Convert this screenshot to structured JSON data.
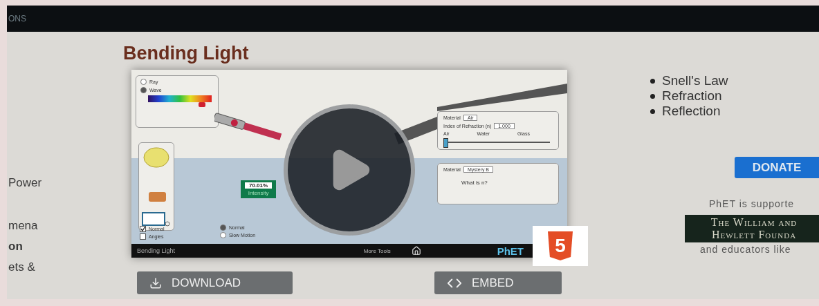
{
  "nav": {
    "label": "ONS"
  },
  "sidebar": {
    "items": [
      {
        "label": "Power",
        "selected": false
      },
      {
        "label": "mena",
        "selected": false
      },
      {
        "label": "on",
        "selected": true
      },
      {
        "label": "ets &",
        "selected": false
      }
    ]
  },
  "title": "Bending Light",
  "simulation": {
    "light_modes": [
      {
        "label": "Ray",
        "selected": false
      },
      {
        "label": "Wave",
        "selected": true
      }
    ],
    "wavelength": {
      "level": 0.85
    },
    "intensity": {
      "reading": "70.01%",
      "label": "Intensity"
    },
    "top_material": {
      "label": "Material",
      "value": "Air",
      "index_label": "Index of Refraction (n)",
      "index_value": "1.000",
      "ticks": [
        "Air",
        "Water",
        "Glass"
      ],
      "level": 0
    },
    "bottom_material": {
      "label": "Material",
      "value": "Mystery B",
      "question": "What is n?"
    },
    "checkboxes": [
      {
        "label": "Normal",
        "checked": true
      },
      {
        "label": "Angles",
        "checked": false
      }
    ],
    "speeds": [
      {
        "label": "Normal",
        "selected": true
      },
      {
        "label": "Slow Motion",
        "selected": false
      }
    ],
    "footer": {
      "title": "Bending Light",
      "more_tools": "More Tools",
      "logo": "PhET"
    },
    "badge": "5"
  },
  "actions": [
    {
      "label": "DOWNLOAD",
      "kind": "download"
    },
    {
      "label": "EMBED",
      "kind": "embed"
    }
  ],
  "topics": [
    "Snell's Law",
    "Refraction",
    "Reflection"
  ],
  "donate": "DONATE",
  "support": {
    "text": "PhET is supporte",
    "sponsor": [
      "The William and",
      "Hewlett Founda"
    ],
    "more": "and educators like"
  }
}
